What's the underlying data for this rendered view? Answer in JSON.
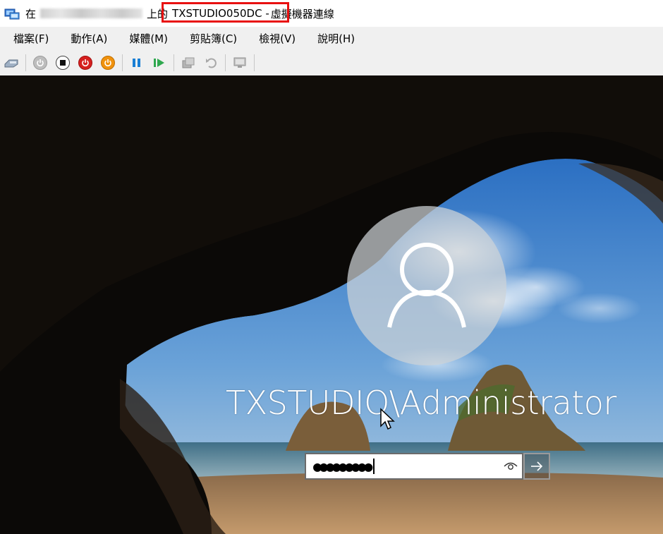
{
  "titlebar": {
    "prefix": "在",
    "host_redacted": "",
    "middle": "上的",
    "vm_name": "TXSTUDIO050DC - ",
    "suffix": "虛擬機器連線"
  },
  "menu": {
    "items": [
      {
        "label": "檔案(F)"
      },
      {
        "label": "動作(A)"
      },
      {
        "label": "媒體(M)"
      },
      {
        "label": "剪貼簿(C)"
      },
      {
        "label": "檢視(V)"
      },
      {
        "label": "說明(H)"
      }
    ]
  },
  "toolbar": {
    "buttons": [
      {
        "icon": "ctrl-alt-del-icon"
      },
      {
        "icon": "start-icon"
      },
      {
        "icon": "turn-off-icon"
      },
      {
        "icon": "shut-down-icon"
      },
      {
        "icon": "save-icon"
      },
      {
        "icon": "pause-icon"
      },
      {
        "icon": "resume-icon"
      },
      {
        "icon": "checkpoint-icon"
      },
      {
        "icon": "revert-icon"
      },
      {
        "icon": "enhanced-session-icon"
      }
    ],
    "colors": {
      "shutdown_red": "#d6201f",
      "save_orange": "#f0920e",
      "pause_blue": "#1a7fd4",
      "resume_green": "#2fa84f"
    }
  },
  "login": {
    "username": "TXSTUDIO\\Administrator",
    "password_mask": "●●●●●●●●●",
    "avatar_icon": "user-icon",
    "reveal_icon": "eye-icon",
    "submit_icon": "arrow-right-icon"
  }
}
